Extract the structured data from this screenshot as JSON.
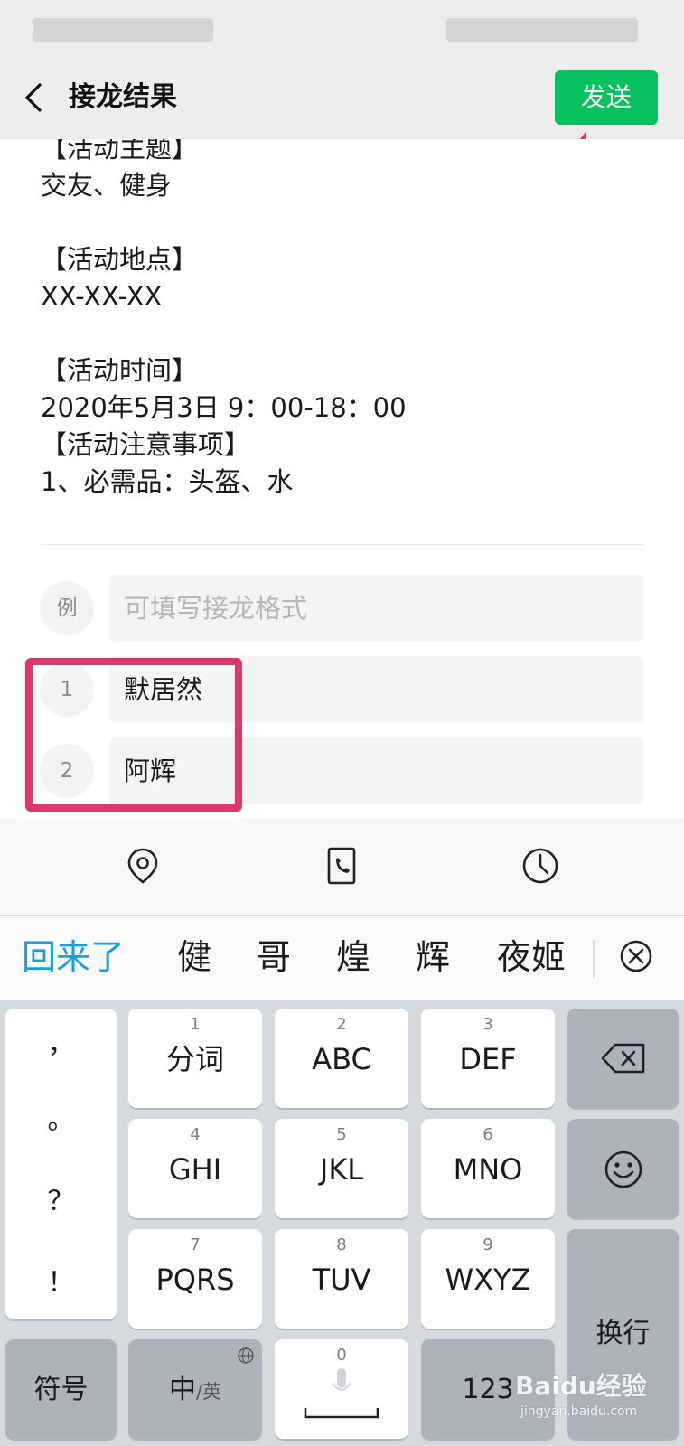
{
  "header": {
    "title": "接龙结果",
    "send_label": "发送"
  },
  "content": {
    "description": "【活动主题】\n交友、健身\n\n【活动地点】\nXX-XX-XX\n\n【活动时间】\n2020年5月3日 9：00-18：00\n【活动注意事项】\n1、必需品：头盔、水",
    "example": {
      "badge": "例",
      "placeholder": "可填写接龙格式"
    },
    "entries": [
      {
        "num": "1",
        "name": "默居然"
      },
      {
        "num": "2",
        "name": "阿辉"
      }
    ]
  },
  "toolbar": {
    "icons": [
      "location-icon",
      "phone-icon",
      "clock-icon"
    ]
  },
  "candidates": [
    "回来了",
    "健",
    "哥",
    "煌",
    "辉",
    "夜姬"
  ],
  "keyboard": {
    "punct": [
      "，",
      "。",
      "？",
      "！"
    ],
    "keys": [
      {
        "num": "1",
        "label": "分词"
      },
      {
        "num": "2",
        "label": "ABC"
      },
      {
        "num": "3",
        "label": "DEF"
      },
      {
        "num": "4",
        "label": "GHI"
      },
      {
        "num": "5",
        "label": "JKL"
      },
      {
        "num": "6",
        "label": "MNO"
      },
      {
        "num": "7",
        "label": "PQRS"
      },
      {
        "num": "8",
        "label": "TUV"
      },
      {
        "num": "9",
        "label": "WXYZ"
      }
    ],
    "symbol_label": "符号",
    "lang_main": "中",
    "lang_sub": "/英",
    "space_num": "0",
    "num_label": "123",
    "enter_label": "换行"
  },
  "watermark": {
    "logo": "Baidu经验",
    "url": "jingyan.baidu.com"
  },
  "colors": {
    "accent_green": "#07c160",
    "highlight_pink": "#e0366f",
    "candidate_blue": "#1aa0d8"
  }
}
